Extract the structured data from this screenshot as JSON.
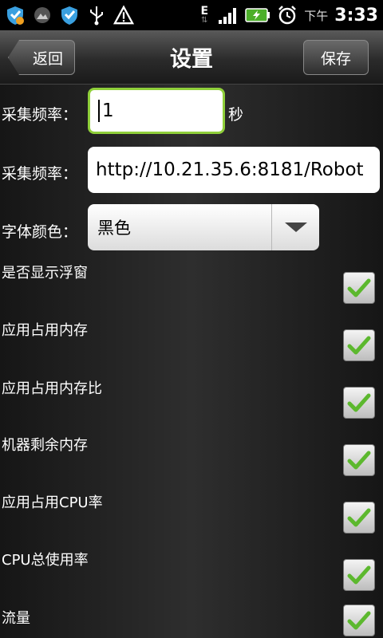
{
  "status_bar": {
    "icons": [
      "shield-icon",
      "image-icon",
      "shield-check-icon",
      "usb-icon",
      "warning-icon",
      "network-e-icon",
      "signal-icon",
      "battery-charging-icon",
      "alarm-clock-icon"
    ],
    "network_label": "E",
    "time_prefix": "下午",
    "time": "3:33"
  },
  "titlebar": {
    "back_label": "返回",
    "title": "设置",
    "save_label": "保存"
  },
  "form": {
    "frequency_label": "采集频率：",
    "frequency_value": "1",
    "frequency_unit": "秒",
    "url_label": "采集频率：",
    "url_value": "http://10.21.35.6:8181/Robot",
    "font_color_label": "字体颜色：",
    "font_color_value": "黑色"
  },
  "checkboxes": [
    {
      "label": "是否显示浮窗",
      "checked": true
    },
    {
      "label": "应用占用内存",
      "checked": true
    },
    {
      "label": "应用占用内存比",
      "checked": true
    },
    {
      "label": "机器剩余内存",
      "checked": true
    },
    {
      "label": "应用占用CPU率",
      "checked": true
    },
    {
      "label": "CPU总使用率",
      "checked": true
    },
    {
      "label": "流量",
      "checked": true
    }
  ],
  "colors": {
    "accent_green": "#8fcf3a",
    "check_green": "#5cb82e"
  }
}
